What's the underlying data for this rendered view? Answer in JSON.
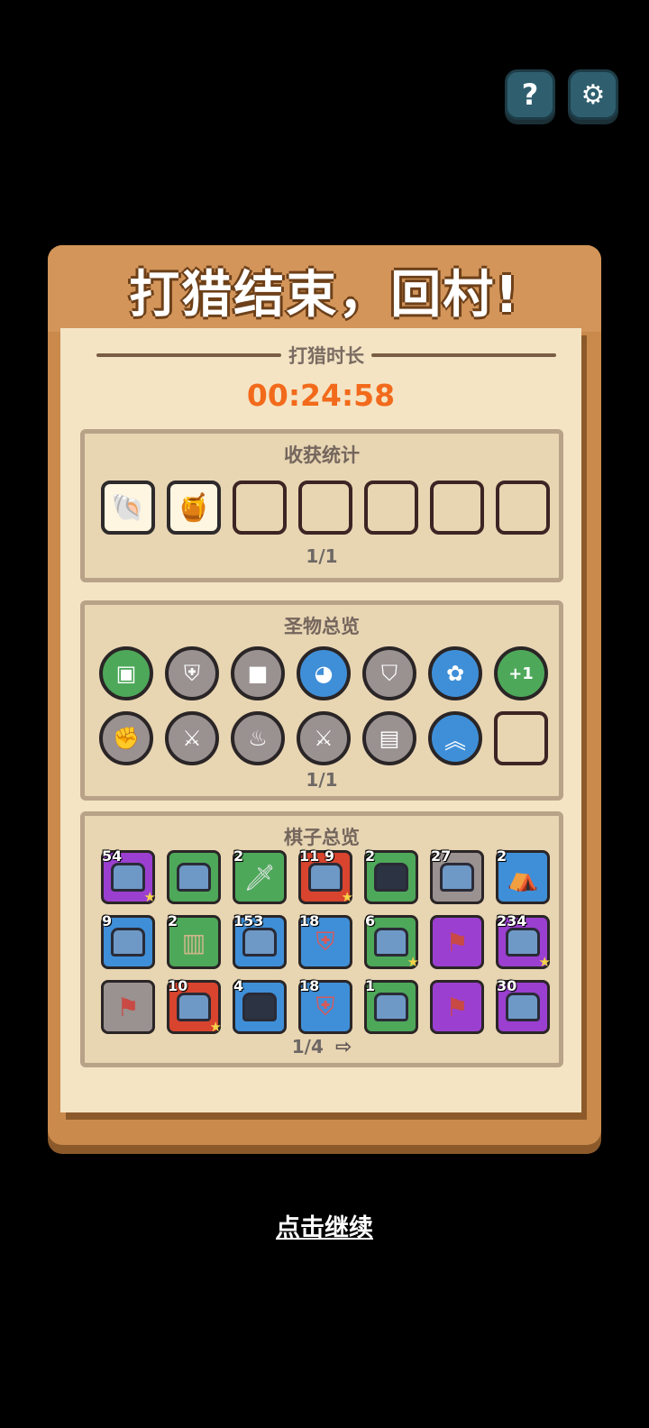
{
  "header": {
    "help_label": "?",
    "settings_icon": "gear-icon"
  },
  "panel": {
    "title": "打猎结束，回村!",
    "time_label": "打猎时长",
    "time_value": "00:24:58"
  },
  "harvest": {
    "title": "收获统计",
    "pager": "1/1",
    "slots": [
      {
        "icon": "shell-icon",
        "filled": true
      },
      {
        "icon": "honey-jar-icon",
        "filled": true
      },
      {
        "icon": "empty",
        "filled": false
      },
      {
        "icon": "empty",
        "filled": false
      },
      {
        "icon": "empty",
        "filled": false
      },
      {
        "icon": "empty",
        "filled": false
      },
      {
        "icon": "empty",
        "filled": false
      }
    ]
  },
  "relics": {
    "title": "圣物总览",
    "pager": "1/1",
    "items": [
      {
        "icon": "green-block-relic-icon",
        "color": "#4ea85a"
      },
      {
        "icon": "shield-relic-icon",
        "color": "#9a9191"
      },
      {
        "icon": "blue-squad-relic-icon",
        "color": "#9a9191"
      },
      {
        "icon": "ghost-relic-icon",
        "color": "#3f8fd8"
      },
      {
        "icon": "golden-shield-relic-icon",
        "color": "#9a9191"
      },
      {
        "icon": "gift-relic-icon",
        "color": "#3f8fd8"
      },
      {
        "icon": "plus-one-relic-icon",
        "color": "#4ea85a",
        "text": "+1"
      },
      {
        "icon": "fist-relic-icon",
        "color": "#9a9191"
      },
      {
        "icon": "fire-sword-relic-icon",
        "color": "#9a9191"
      },
      {
        "icon": "flame-relic-icon",
        "color": "#9a9191"
      },
      {
        "icon": "sword-relic-icon",
        "color": "#9a9191"
      },
      {
        "icon": "machine-relic-icon",
        "color": "#9a9191"
      },
      {
        "icon": "chevron-up-relic-icon",
        "color": "#3f8fd8"
      },
      {
        "icon": "empty",
        "color": "transparent"
      }
    ]
  },
  "pieces": {
    "title": "棋子总览",
    "pager": "1/4",
    "items": [
      {
        "badge": "54",
        "color": "#9b3fd0",
        "kind": "unit",
        "star": true
      },
      {
        "badge": "",
        "color": "#4ea85a",
        "kind": "unit",
        "star": false
      },
      {
        "badge": "2",
        "color": "#4ea85a",
        "kind": "sword",
        "star": false
      },
      {
        "badge": "11\n9",
        "color": "#d9442e",
        "kind": "unit",
        "star": true
      },
      {
        "badge": "2",
        "color": "#4ea85a",
        "kind": "ninja",
        "star": false
      },
      {
        "badge": "27",
        "color": "#9a9191",
        "kind": "unit",
        "star": false
      },
      {
        "badge": "2",
        "color": "#3f8fd8",
        "kind": "tent",
        "star": false
      },
      {
        "badge": "9",
        "color": "#3f8fd8",
        "kind": "unit",
        "star": false
      },
      {
        "badge": "2",
        "color": "#4ea85a",
        "kind": "fence",
        "star": false
      },
      {
        "badge": "153",
        "color": "#3f8fd8",
        "kind": "unit",
        "star": false
      },
      {
        "badge": "18",
        "color": "#3f8fd8",
        "kind": "shield",
        "star": false
      },
      {
        "badge": "6",
        "color": "#4ea85a",
        "kind": "unit",
        "star": true
      },
      {
        "badge": "",
        "color": "#9b3fd0",
        "kind": "flag",
        "star": false
      },
      {
        "badge": "234",
        "color": "#9b3fd0",
        "kind": "unit",
        "star": true
      },
      {
        "badge": "",
        "color": "#9a9191",
        "kind": "flag",
        "star": false
      },
      {
        "badge": "10",
        "color": "#d9442e",
        "kind": "unit",
        "star": true
      },
      {
        "badge": "4",
        "color": "#3f8fd8",
        "kind": "ninja",
        "star": false
      },
      {
        "badge": "18",
        "color": "#3f8fd8",
        "kind": "shield",
        "star": false
      },
      {
        "badge": "1",
        "color": "#4ea85a",
        "kind": "unit",
        "star": false
      },
      {
        "badge": "",
        "color": "#9b3fd0",
        "kind": "flag",
        "star": false
      },
      {
        "badge": "30",
        "color": "#9b3fd0",
        "kind": "unit",
        "star": false
      }
    ]
  },
  "footer": {
    "continue_label": "点击继续"
  }
}
